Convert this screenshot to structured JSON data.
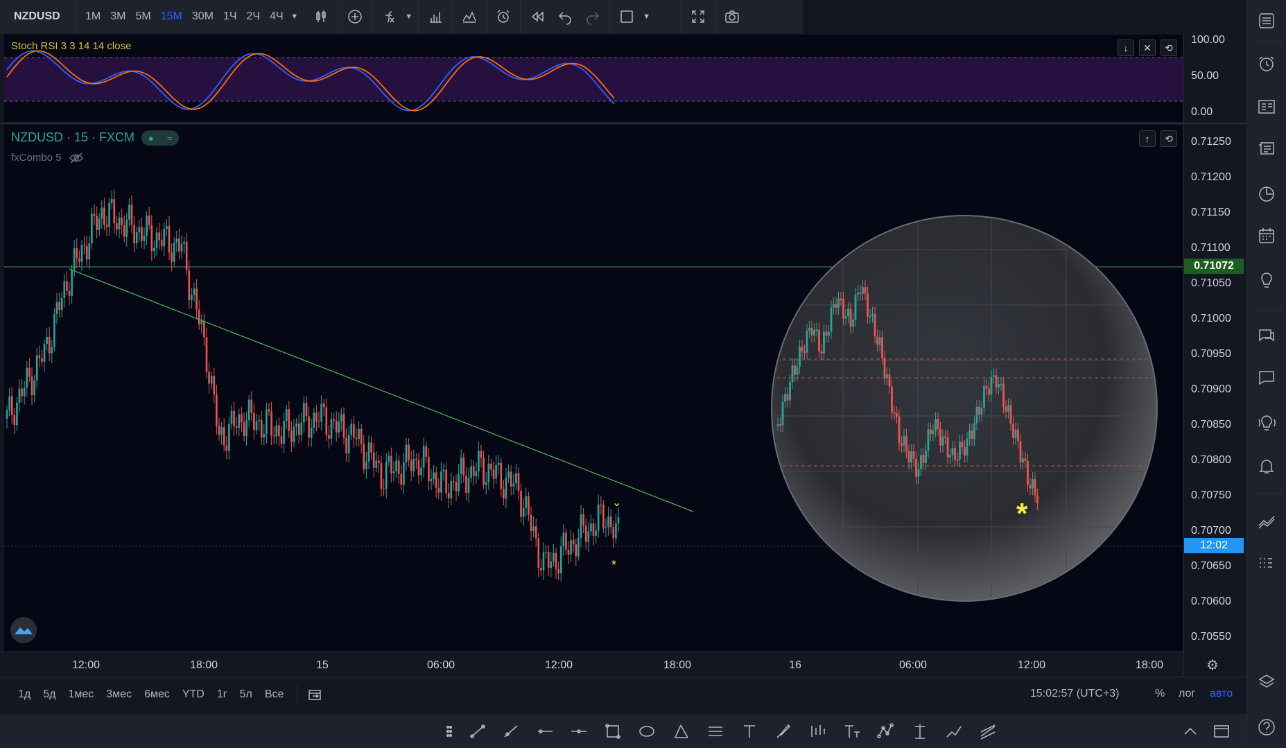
{
  "toolbar": {
    "symbol": "NZDUSD",
    "timeframes": [
      "1M",
      "3M",
      "5M",
      "15M",
      "30M",
      "1Ч",
      "2Ч",
      "4Ч"
    ],
    "active_timeframe": "15M",
    "icons": [
      "candles-icon",
      "add-indicator-icon",
      "fx-icon",
      "bar-chart-icon",
      "compare-icon",
      "alert-icon",
      "replay-icon",
      "undo-icon",
      "redo-icon",
      "layout-icon",
      "fullscreen-icon",
      "camera-icon"
    ]
  },
  "stoch_pane": {
    "legend": "Stoch RSI 3 3 14 14 close",
    "axis_labels": [
      "100.00",
      "50.00",
      "0.00"
    ],
    "band_color": "#26103f",
    "k_color": "#2962ff",
    "d_color": "#ff6d00"
  },
  "main_pane": {
    "legend_symbol": "NZDUSD · 15 · FXCM",
    "indicator_legend": "fxCombo 5",
    "price_labels": [
      "0.71250",
      "0.71200",
      "0.71150",
      "0.71100",
      "0.71050",
      "0.71000",
      "0.70950",
      "0.70900",
      "0.70850",
      "0.70800",
      "0.70750",
      "0.70700",
      "0.70650",
      "0.70600",
      "0.70550"
    ],
    "level_price": "0.71072",
    "countdown": "12:02",
    "time_labels": [
      "12:00",
      "18:00",
      "15",
      "06:00",
      "12:00",
      "18:00",
      "16",
      "06:00",
      "12:00",
      "18:00"
    ],
    "up_color": "#26a69a",
    "down_color": "#ef5350",
    "trendline_color": "#4caf50"
  },
  "range_bar": {
    "ranges": [
      "1д",
      "5д",
      "1мес",
      "3мес",
      "6мес",
      "YTD",
      "1г",
      "5л",
      "Все"
    ],
    "clock": "15:02:57 (UTC+3)",
    "percent": "%",
    "log": "лог",
    "auto": "авто"
  },
  "colors": {
    "accent": "#2962ff",
    "marker": "#ffeb3b"
  }
}
